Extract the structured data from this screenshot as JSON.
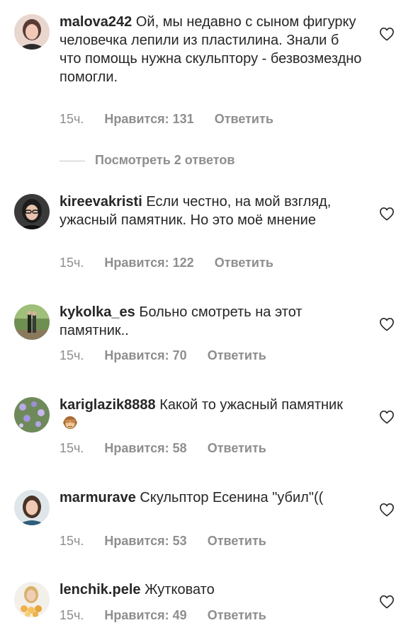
{
  "comments": [
    {
      "username": "malova242",
      "text": "Ой, мы недавно с сыном фигурку человечка лепили из пластилина. Знали б что помощь нужна скульптору - безвозмездно помогли.",
      "time": "15ч.",
      "likes": "Нравится: 131",
      "reply": "Ответить"
    },
    {
      "username": "kireevakristi",
      "text": "Если честно, на мой взгляд, ужасный памятник. Но это моё мнение",
      "time": "15ч.",
      "likes": "Нравится: 122",
      "reply": "Ответить"
    },
    {
      "username": "kykolka_es",
      "text": "Больно смотреть на этот памятник..",
      "time": "15ч.",
      "likes": "Нравится: 70",
      "reply": "Ответить"
    },
    {
      "username": "kariglazik8888",
      "text": "Какой то ужасный памятник",
      "emoji": "see-no-evil-monkey",
      "time": "15ч.",
      "likes": "Нравится: 58",
      "reply": "Ответить"
    },
    {
      "username": "marmurave",
      "text": "Скульптор Есенина \"убил\"((",
      "time": "15ч.",
      "likes": "Нравится: 53",
      "reply": "Ответить"
    },
    {
      "username": "lenchik.pele",
      "text": "Жутковато",
      "time": "15ч.",
      "likes": "Нравится: 49",
      "reply": "Ответить"
    }
  ],
  "view_replies": "Посмотреть 2 ответов",
  "icons": {
    "like": "heart-outline-icon",
    "avatar": "user-avatar"
  },
  "colors": {
    "text": "#262626",
    "secondary": "#8e8e8e"
  }
}
